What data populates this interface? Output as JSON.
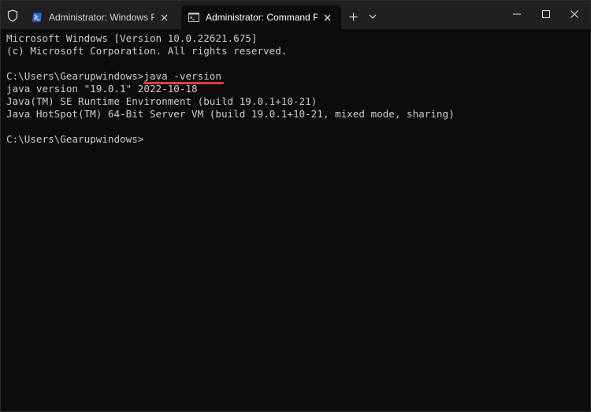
{
  "tabs": [
    {
      "label": "Administrator: Windows PowerShell",
      "icon": "powershell-icon",
      "active": false
    },
    {
      "label": "Administrator: Command Prompt",
      "icon": "cmd-icon",
      "active": true
    }
  ],
  "terminal": {
    "lines": [
      "Microsoft Windows [Version 10.0.22621.675]",
      "(c) Microsoft Corporation. All rights reserved.",
      "",
      "",
      "java version \"19.0.1\" 2022-10-18",
      "Java(TM) SE Runtime Environment (build 19.0.1+10-21)",
      "Java HotSpot(TM) 64-Bit Server VM (build 19.0.1+10-21, mixed mode, sharing)",
      "",
      "C:\\Users\\Gearupwindows>"
    ],
    "prompt": "C:\\Users\\Gearupwindows>",
    "command": "java -version"
  },
  "colors": {
    "titlebar": "#202020",
    "terminal_bg": "#0c0c0c",
    "text": "#cccccc",
    "highlight_underline": "#e23b3b",
    "powershell_icon": "#2d6bd4"
  }
}
